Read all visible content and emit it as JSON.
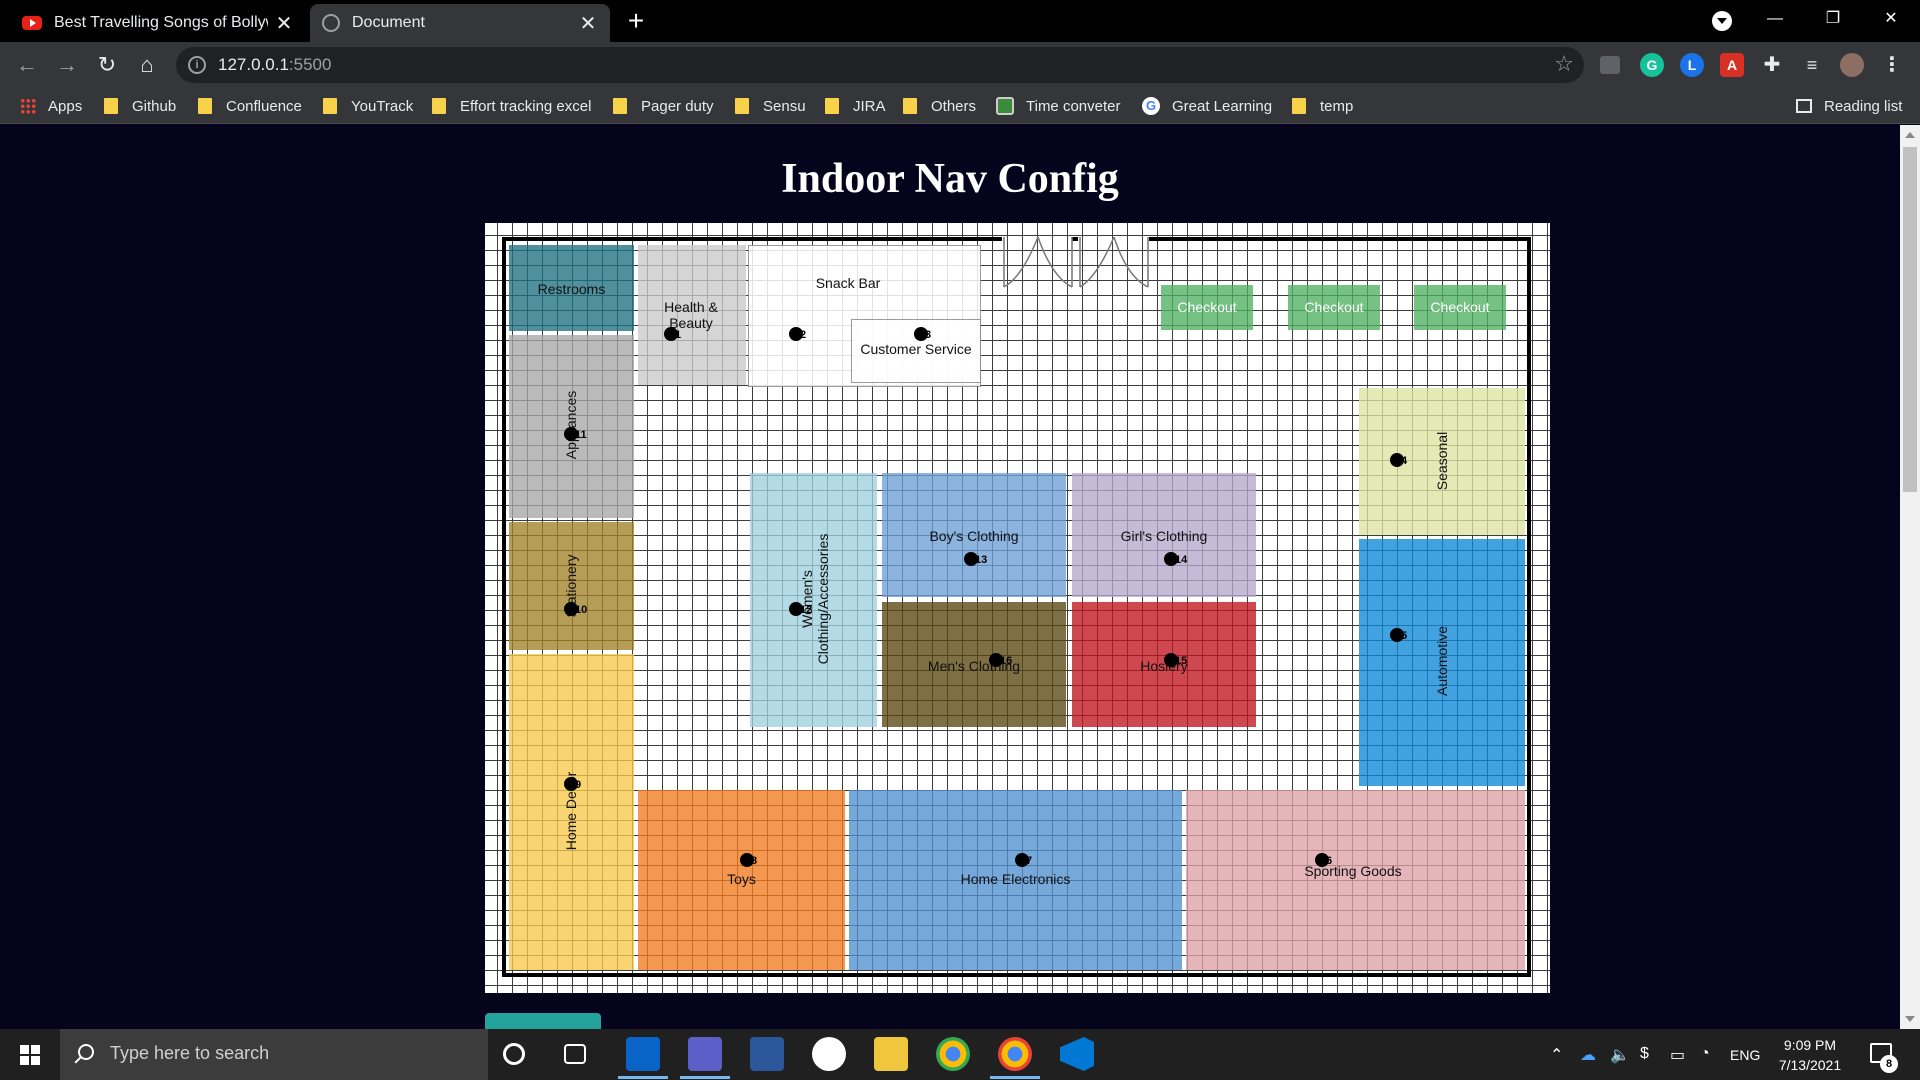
{
  "browser": {
    "tabs": [
      {
        "title": "Best Travelling Songs of Bollywo",
        "close": "✕"
      },
      {
        "title": "Document",
        "close": "✕"
      }
    ],
    "new_tab": "+",
    "window_controls": {
      "minimize": "—",
      "restore": "❐",
      "close": "✕"
    },
    "nav": {
      "back": "←",
      "forward": "→",
      "reload": "↻",
      "home": "⌂"
    },
    "url_host": "127.0.0.1",
    "url_port": ":5500",
    "bookmark_star": "☆",
    "extensions": [
      "cast-icon",
      "grammarly-icon",
      "lastpass-icon",
      "acrobat-icon",
      "puzzle-icon",
      "media-icon",
      "avatar"
    ],
    "ext_letters": {
      "grammarly": "G",
      "lastpass": "L",
      "acrobat": "A"
    },
    "bookmarks": [
      "Apps",
      "Github",
      "Confluence",
      "YouTrack",
      "Effort tracking excel",
      "Pager duty",
      "Sensu",
      "JIRA",
      "Others",
      "Time conveter",
      "Great Learning",
      "temp"
    ],
    "reading_list": "Reading list",
    "google_letter": "G"
  },
  "page": {
    "title": "Indoor Nav Config"
  },
  "map": {
    "colors": {
      "restrooms": "#1f6f80",
      "health": "#c9c9c9",
      "appliances": "#a6a6a6",
      "stationery": "#a08128",
      "homedecor": "#f6c94a",
      "toys": "#ef7a20",
      "electronics": "#4f8fd0",
      "sporting": "#dca2a5",
      "automotive": "#0d86d6",
      "seasonal": "#dde3a0",
      "womens": "#9ed0de",
      "boys": "#6c9fd6",
      "girls": "#b6a8cc",
      "mens": "#5a4710",
      "hosiery": "#c0141e",
      "checkout": "#4fb163"
    },
    "rooms": {
      "restrooms": "Restrooms",
      "health": "Health & Beauty",
      "snackbar": "Snack Bar",
      "customer_service": "Customer Service",
      "checkout1": "Checkout",
      "checkout2": "Checkout",
      "checkout3": "Checkout",
      "appliances": "Appliances",
      "stationery": "Stationery",
      "homedecor": "Home Decor",
      "toys": "Toys",
      "electronics": "Home Electronics",
      "sporting": "Sporting Goods",
      "automotive": "Automotive",
      "seasonal": "Seasonal",
      "womens": "Women's Clothing/Accessories",
      "boys": "Boy's Clothing",
      "girls": "Girl's Clothing",
      "mens": "Men's Clothing",
      "hosiery": "Hosiery"
    },
    "nodes": [
      "1",
      "2",
      "3",
      "4",
      "5",
      "6",
      "7",
      "8",
      "9",
      "10",
      "11",
      "12",
      "13",
      "14",
      "15",
      "16"
    ]
  },
  "taskbar": {
    "search_placeholder": "Type here to search",
    "time": "9:09 PM",
    "date": "7/13/2021",
    "lang": "ENG",
    "notifications": "8"
  }
}
